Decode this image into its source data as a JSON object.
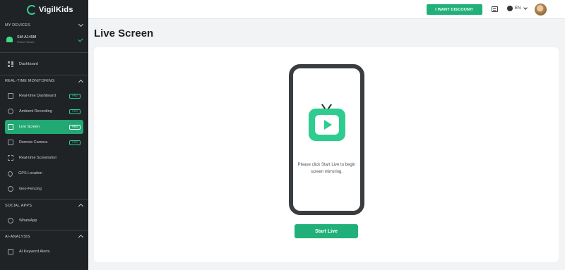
{
  "brand": {
    "name": "VigilKids",
    "accent": "#2ecc8f"
  },
  "sidebar": {
    "devices_header": "MY DEVICES",
    "device": {
      "name": "SM-A145M",
      "subtitle": "Phone Viewer"
    },
    "dashboard": "Dashboard",
    "sections": [
      {
        "title": "REAL-TIME MONITORING",
        "items": [
          {
            "label": "Real-time Dashboard",
            "badge": "PRO"
          },
          {
            "label": "Ambient Recording",
            "badge": "PRO"
          },
          {
            "label": "Live Screen",
            "badge": "PRO",
            "active": true
          },
          {
            "label": "Remote Camera",
            "badge": "PRO"
          },
          {
            "label": "Real-time Screenshot"
          },
          {
            "label": "GPS Location"
          },
          {
            "label": "Geo-Fencing"
          }
        ]
      },
      {
        "title": "SOCIAL APPS",
        "items": [
          {
            "label": "WhatsApp"
          }
        ]
      },
      {
        "title": "AI-ANALYSIS",
        "items": [
          {
            "label": "AI Keyword Alerts"
          }
        ]
      }
    ]
  },
  "topbar": {
    "discount_label": "I WANT DISCOUNT!",
    "language": "EN"
  },
  "main": {
    "title": "Live Screen",
    "phone_message": "Please click Start Live to begin screen mirroring.",
    "start_label": "Start Live"
  }
}
